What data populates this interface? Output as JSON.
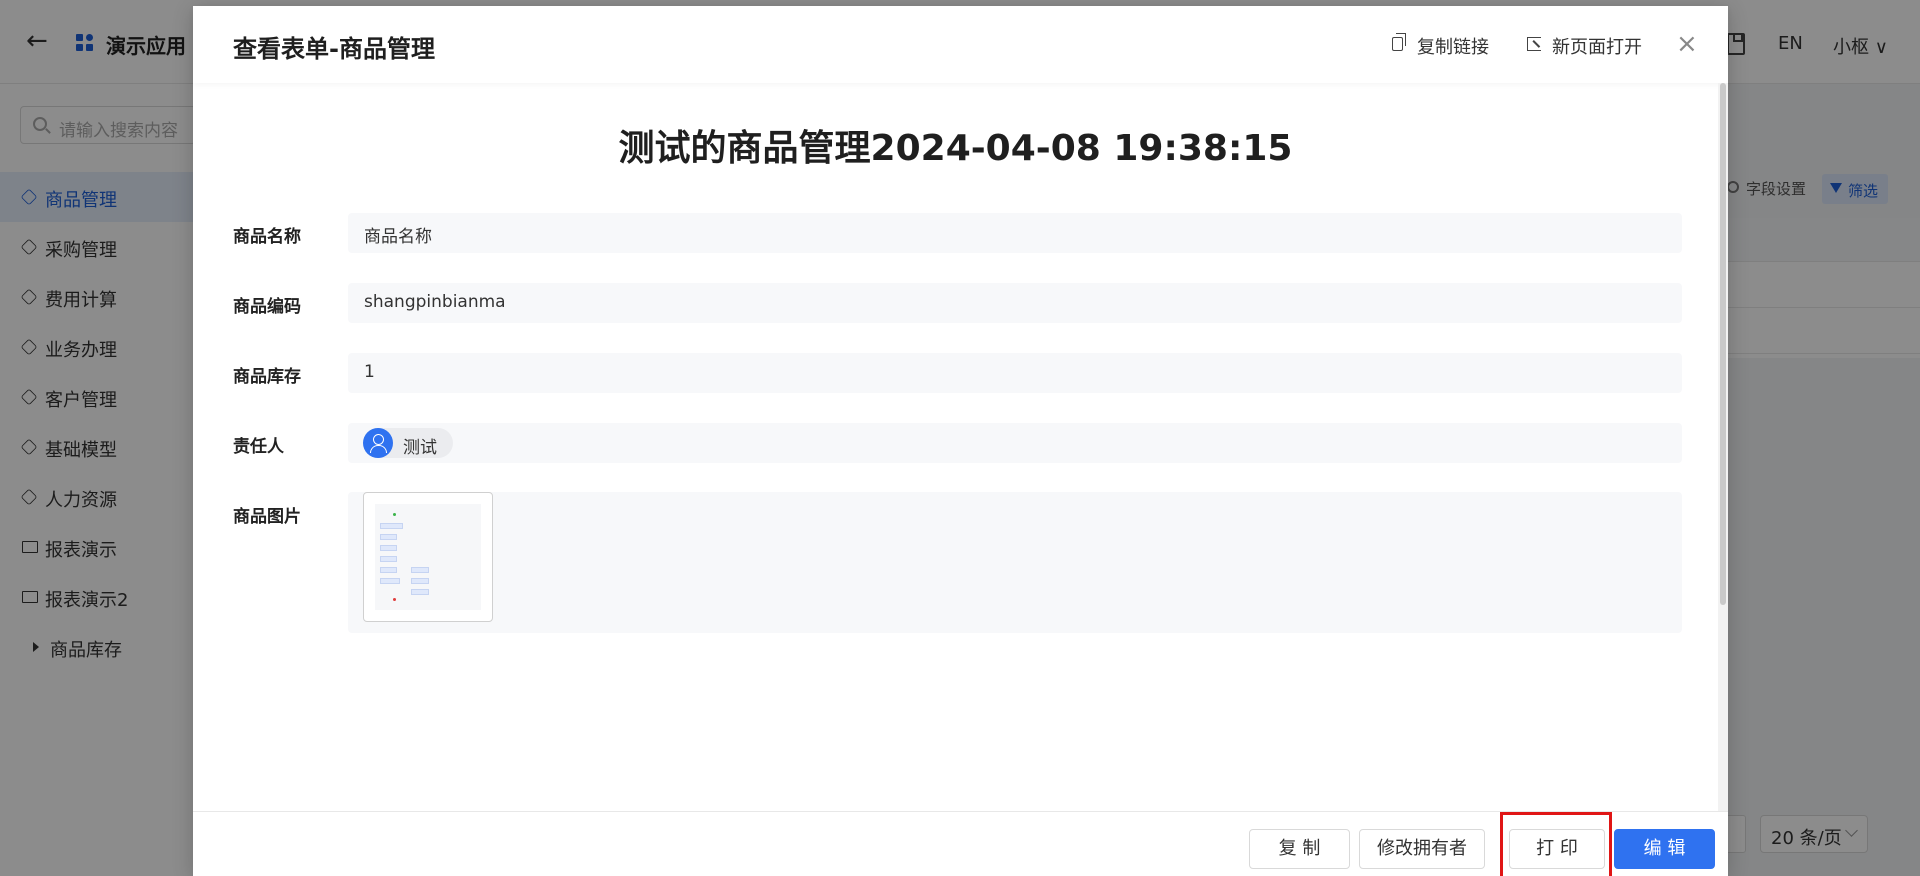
{
  "app": {
    "title": "演示应用",
    "lang": "EN",
    "user": "小枢 ∨"
  },
  "sidebar": {
    "search_placeholder": "请输入搜索内容",
    "items": [
      {
        "label": "商品管理"
      },
      {
        "label": "采购管理"
      },
      {
        "label": "费用计算"
      },
      {
        "label": "业务办理"
      },
      {
        "label": "客户管理"
      },
      {
        "label": "基础模型"
      },
      {
        "label": "人力资源"
      },
      {
        "label": "报表演示"
      },
      {
        "label": "报表演示2"
      },
      {
        "label": "商品库存"
      }
    ]
  },
  "background": {
    "field_settings": "字段设置",
    "filter": "筛选",
    "page_size": "20 条/页"
  },
  "modal": {
    "title": "查看表单-商品管理",
    "copy_link": "复制链接",
    "open_new_page": "新页面打开",
    "close": "×",
    "form_title": "测试的商品管理2024-04-08 19:38:15",
    "fields": {
      "name": {
        "label": "商品名称",
        "value": "商品名称"
      },
      "code": {
        "label": "商品编码",
        "value": "shangpinbianma"
      },
      "stock": {
        "label": "商品库存",
        "value": "1"
      },
      "owner": {
        "label": "责任人",
        "value": "测试"
      },
      "image": {
        "label": "商品图片"
      }
    },
    "footer": {
      "copy": "复 制",
      "change_owner": "修改拥有者",
      "print": "打 印",
      "edit": "编 辑"
    },
    "colors": {
      "primary": "#2f72f0",
      "highlight": "#e01515"
    }
  }
}
